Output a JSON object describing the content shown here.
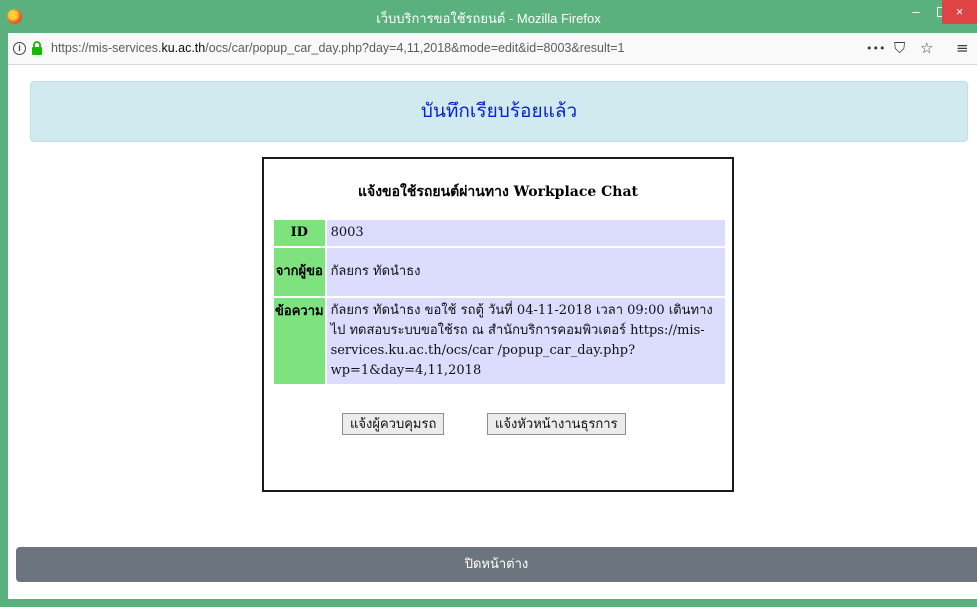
{
  "window": {
    "title": "เว็บบริการขอใช้รถยนต์ - Mozilla Firefox",
    "minimize": "–",
    "close": "×"
  },
  "urlbar": {
    "url_prefix": "https://mis-services.",
    "url_domain": "ku.ac.th",
    "url_path": "/ocs/car/popup_car_day.php?day=4,11,2018&mode=edit&id=8003&result=1",
    "info_glyph": "i",
    "more_glyph": "•••",
    "pocket_glyph": "⛉",
    "star_glyph": "☆",
    "menu_glyph": "≡"
  },
  "alert": {
    "text": "บันทึกเรียบร้อยแล้ว"
  },
  "card": {
    "title": "แจ้งขอใช้รถยนต์ผ่านทาง Workplace Chat",
    "rows": [
      {
        "label": "ID",
        "value": "8003"
      },
      {
        "label": "จากผู้ขอ",
        "value": "กัลยกร ทัดนำธง"
      },
      {
        "label": "ข้อความ",
        "value": "กัลยกร ทัดนำธง ขอใช้ รถตู้ วันที่ 04-11-2018 เวลา 09:00 เดินทางไป ทดสอบระบบขอใช้รถ ณ สำนักบริการคอมพิวเตอร์ https://mis-services.ku.ac.th/ocs/car /popup_car_day.php?wp=1&day=4,11,2018"
      }
    ],
    "button_notify_controller": "แจ้งผู้ควบคุมรถ",
    "button_notify_head": "แจ้งหัวหน้างานธุรการ"
  },
  "footer": {
    "close_label": "ปิดหน้าต่าง"
  },
  "colors": {
    "titlebar": "#5ab17e",
    "alert_bg": "#d0eaf0",
    "alert_text": "#0b1fd6",
    "label_bg": "#7ee37f",
    "value_bg": "#dcdcfe",
    "footer_bg": "#6c757d",
    "close_button": "#e04343"
  }
}
